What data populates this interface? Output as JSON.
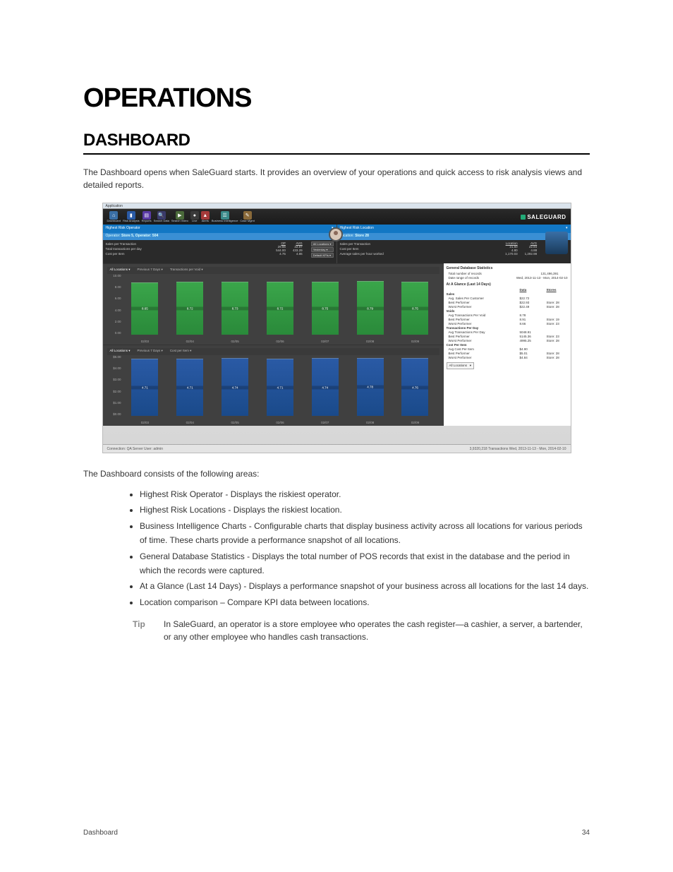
{
  "doc": {
    "title": "OPERATIONS",
    "section": "DASHBOARD",
    "intro": "The Dashboard opens when SaleGuard starts. It provides an overview of your operations and quick access to risk analysis views and detailed reports.",
    "post_heading": "The Dashboard consists of the following areas:",
    "features": [
      "Highest Risk Operator - Displays the riskiest operator.",
      "Highest Risk Locations - Displays the riskiest location.",
      "Business Intelligence Charts - Configurable charts that display business activity across all locations for various periods of time. These charts provide a performance snapshot of all locations.",
      "General Database Statistics - Displays the total number of POS records that exist in the database and the period in which the records were captured.",
      "At a Glance (Last 14 Days) - Displays a performance snapshot of your business across all locations for the last 14 days.",
      "Location comparison – Compare KPI data between locations."
    ],
    "tip_label": "Tip",
    "tip_text": "In SaleGuard, an operator is a store employee who operates the cash register—a cashier, a server, a bartender, or any other employee who handles cash transactions."
  },
  "footer": {
    "left": "Dashboard",
    "right": "34"
  },
  "app": {
    "menubar": "Application",
    "toolbar": {
      "buttons": [
        {
          "label": "Dashboard"
        },
        {
          "label": "Risk Analysis"
        },
        {
          "label": "Reports"
        },
        {
          "label": "Search Data"
        },
        {
          "label": "Search Video"
        },
        {
          "label": "Live"
        },
        {
          "label": "Alerts"
        },
        {
          "label": "Business Intelligence"
        },
        {
          "label": "Case Mgmt"
        }
      ],
      "brand": "SALEGUARD"
    },
    "risk_operator": {
      "header": "Highest Risk Operator",
      "sub_label": "Operator:",
      "sub_value": "Store 5, Operator: 504",
      "rows": [
        {
          "label": "Sales per Transaction",
          "op": "29.56",
          "avg": "22.87"
        },
        {
          "label": "Total transactions per day",
          "op": "544.00",
          "avg": "433.29"
        },
        {
          "label": "Cost per Item",
          "op": "4.75",
          "avg": "4.86"
        }
      ],
      "col_op": "OP",
      "col_avg": "AVG",
      "dropdowns": [
        "All Locations",
        "Yesterday",
        "Default KPIs"
      ]
    },
    "risk_location": {
      "header": "Highest Risk Location",
      "sub_label": "Location:",
      "sub_value": "Store 28",
      "rows": [
        {
          "label": "Sales per Transaction",
          "loc": "21.60",
          "avg": "22.84"
        },
        {
          "label": "Cost per Item",
          "loc": "4.80",
          "avg": "4.88"
        },
        {
          "label": "Average sales per hour worked",
          "loc": "1,170.03",
          "avg": "1,292.98"
        }
      ],
      "col_loc": "Location",
      "col_avg": "AVG",
      "dropdowns": [
        "Yesterday",
        "Default KPIs"
      ]
    },
    "chart1": {
      "tabs": [
        "All Locations",
        "Previous 7 Days",
        "Transactions per Void"
      ],
      "y": [
        "10.00",
        "8.00",
        "6.00",
        "4.00",
        "2.00",
        "0.00"
      ]
    },
    "chart2": {
      "tabs": [
        "All Locations",
        "Previous 7 Days",
        "Cost per Item"
      ],
      "y": [
        "$5.00",
        "$4.00",
        "$3.00",
        "$2.00",
        "$1.00",
        "$0.00"
      ]
    },
    "stats": {
      "title": "General Database Statistics",
      "total_label": "Total number of records",
      "total": "131,496,391",
      "range_label": "Date range of records",
      "range": "Wed, 2013-11-13 - Mon, 2014-02-10",
      "glance_title": "At A Glance (Last 14 Days)",
      "col_data": "Data",
      "col_store": "Stores",
      "groups": [
        {
          "name": "Sales",
          "rows": [
            {
              "l": "Avg. Sales Per Customer",
              "d": "$22.72",
              "s": ""
            },
            {
              "l": "Best Performer",
              "d": "$22.93",
              "s": "Store: 28"
            },
            {
              "l": "Worst Performer",
              "d": "$22.49",
              "s": "Store: 28"
            }
          ]
        },
        {
          "name": "Voids",
          "rows": [
            {
              "l": "Avg Transactions Per Void",
              "d": "8.78",
              "s": ""
            },
            {
              "l": "Best Performer",
              "d": "8.91",
              "s": "Store: 19"
            },
            {
              "l": "Worst Performer",
              "d": "8.66",
              "s": "Store: 23"
            }
          ]
        },
        {
          "name": "Transactions Per Day",
          "rows": [
            {
              "l": "Avg Transactions Per Day",
              "d": "5048.91",
              "s": ""
            },
            {
              "l": "Best Performer",
              "d": "5145.36",
              "s": "Store: 23"
            },
            {
              "l": "Worst Performer",
              "d": "4995.25",
              "s": "Store: 28"
            }
          ]
        },
        {
          "name": "Cost Per Item",
          "rows": [
            {
              "l": "Avg Cost Per Item",
              "d": "$4.90",
              "s": ""
            },
            {
              "l": "Best Performer",
              "d": "$5.01",
              "s": "Store: 28"
            },
            {
              "l": "Worst Performer",
              "d": "$4.84",
              "s": "Store: 28"
            }
          ]
        }
      ],
      "dd": "All Locations"
    },
    "statusbar": {
      "left": "Connection: QA Server    User: admin",
      "right": "3,9320,218 Transactions Wed, 2013-11-13 - Mon, 2014-02-10"
    }
  },
  "chart_data": [
    {
      "type": "bar",
      "title": "Transactions per Void — All Locations — Previous 7 Days",
      "categories": [
        "02/03",
        "02/04",
        "02/05",
        "02/06",
        "02/07",
        "02/08",
        "02/09"
      ],
      "values": [
        8.65,
        8.72,
        8.73,
        8.72,
        8.75,
        8.79,
        8.75
      ],
      "ylabel": "",
      "xlabel": "",
      "ylim": [
        0,
        10
      ]
    },
    {
      "type": "bar",
      "title": "Cost per Item ($) — All Locations — Previous 7 Days",
      "categories": [
        "02/03",
        "02/04",
        "02/05",
        "02/06",
        "02/07",
        "02/08",
        "02/09"
      ],
      "values": [
        4.71,
        4.71,
        4.74,
        4.71,
        4.74,
        4.78,
        4.76
      ],
      "ylabel": "$",
      "xlabel": "",
      "ylim": [
        0,
        5
      ]
    }
  ]
}
